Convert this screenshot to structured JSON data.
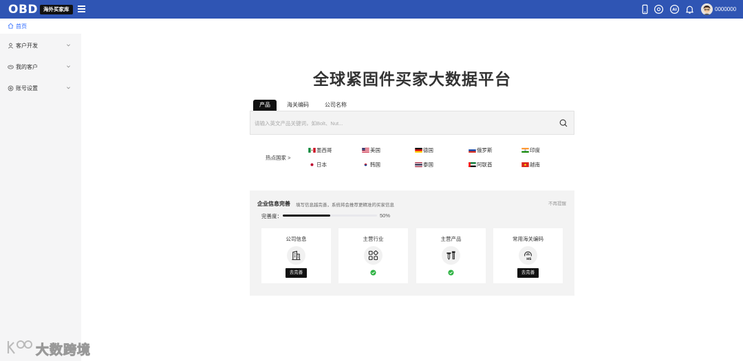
{
  "topbar": {
    "logo": "OBD",
    "badge": "海外买家库",
    "username": "0000000",
    "colors": {
      "bar": "#2f55b4"
    }
  },
  "sidebar": {
    "home": "首页",
    "items": [
      {
        "label": "客户开发",
        "icon": "user-icon"
      },
      {
        "label": "我的客户",
        "icon": "handshake-icon"
      },
      {
        "label": "账号设置",
        "icon": "settings-icon"
      }
    ]
  },
  "main": {
    "title": "全球紧固件买家大数据平台",
    "tabs": [
      "产品",
      "海关编码",
      "公司名称"
    ],
    "active_tab": "产品",
    "search_placeholder": "请输入英文产品关键词，如Bolt、Nut...",
    "hot_label": "热点国家 >",
    "countries": [
      {
        "name": "墨西哥",
        "flag": "mexico-flag"
      },
      {
        "name": "美国",
        "flag": "usa-flag"
      },
      {
        "name": "德国",
        "flag": "germany-flag"
      },
      {
        "name": "俄罗斯",
        "flag": "russia-flag"
      },
      {
        "name": "印度",
        "flag": "india-flag"
      },
      {
        "name": "日本",
        "flag": "japan-flag"
      },
      {
        "name": "韩国",
        "flag": "korea-flag"
      },
      {
        "name": "泰国",
        "flag": "thailand-flag"
      },
      {
        "name": "阿联酋",
        "flag": "uae-flag"
      },
      {
        "name": "越南",
        "flag": "vietnam-flag"
      }
    ]
  },
  "panel": {
    "title": "企业信息完善",
    "subtitle": "填写信息越完善，系统将会推荐更精准的买家信息",
    "dismiss": "不再提醒",
    "progress_label": "完善度：",
    "progress_percent": 50,
    "progress_text": "50%",
    "cards": [
      {
        "title": "公司信息",
        "icon": "building-icon",
        "action": "去完善",
        "done": false
      },
      {
        "title": "主营行业",
        "icon": "grid-icon",
        "action": "",
        "done": true
      },
      {
        "title": "主营产品",
        "icon": "screw-icon",
        "action": "",
        "done": true
      },
      {
        "title": "常用海关编码",
        "icon": "hs-code-icon",
        "action": "去完善",
        "done": false
      }
    ]
  },
  "watermark": "大数跨境"
}
